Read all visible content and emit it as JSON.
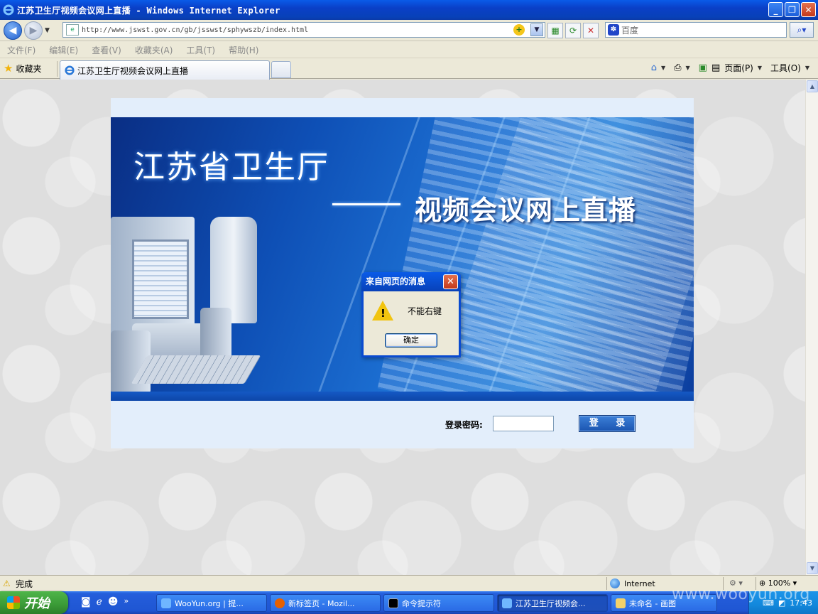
{
  "window": {
    "title": "江苏卫生厅视频会议网上直播 - Windows Internet Explorer",
    "minimize_label": "_",
    "maximize_label": "❐",
    "close_label": "✕"
  },
  "address_bar": {
    "url": "http://www.jswst.gov.cn/gb/jsswst/sphywszb/index.html",
    "search_placeholder": "百度"
  },
  "menu": [
    "文件(F)",
    "编辑(E)",
    "查看(V)",
    "收藏夹(A)",
    "工具(T)",
    "帮助(H)"
  ],
  "favorites_label": "收藏夹",
  "tab": {
    "label": "江苏卫生厅视频会议网上直播"
  },
  "command_bar": {
    "page_label": "页面(P)",
    "tools_label": "工具(O)"
  },
  "page": {
    "banner_title": "江苏省卫生厅",
    "banner_subtitle": "视频会议网上直播",
    "login_label": "登录密码:",
    "login_password_value": "",
    "login_button": "登 录"
  },
  "dialog": {
    "title": "来自网页的消息",
    "message": "不能右键",
    "ok_button": "确定"
  },
  "status_bar": {
    "status_text": "完成",
    "zone": "Internet",
    "zoom": "100%"
  },
  "taskbar": {
    "start_label": "开始",
    "items": [
      {
        "label": "WooYun.org | 提..."
      },
      {
        "label": "新标签页 - Mozil..."
      },
      {
        "label": "命令提示符"
      },
      {
        "label": "江苏卫生厅视频会..."
      },
      {
        "label": "未命名 - 画图"
      }
    ],
    "clock": "17:43"
  },
  "watermark": "www.wooyun.org",
  "colors": {
    "titlebar": "#0a3fc7",
    "banner_blue": "#0e4fb5",
    "panel_bg": "#e3eefb",
    "taskbar": "#245edb",
    "start_green": "#3a9a36"
  }
}
